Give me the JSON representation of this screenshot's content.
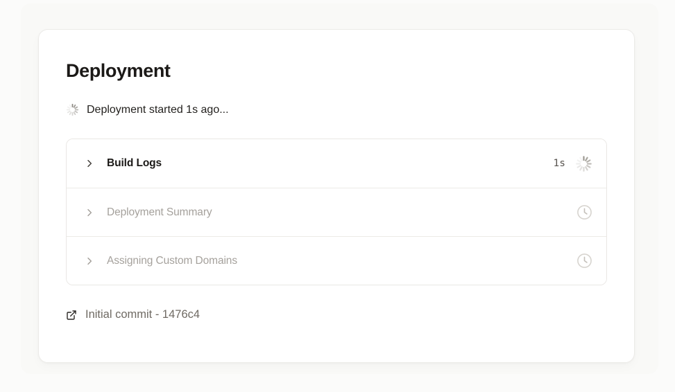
{
  "card": {
    "title": "Deployment",
    "status": {
      "text": "Deployment started 1s ago...",
      "icon": "spinner-icon"
    },
    "steps": [
      {
        "label": "Build Logs",
        "duration": "1s",
        "state": "in-progress",
        "right_icon": "spinner-icon"
      },
      {
        "label": "Deployment Summary",
        "duration": "",
        "state": "pending",
        "right_icon": "clock-icon"
      },
      {
        "label": "Assigning Custom Domains",
        "duration": "",
        "state": "pending",
        "right_icon": "clock-icon"
      }
    ],
    "commit": {
      "label": "Initial commit - 1476c4",
      "icon": "external-link-icon"
    }
  },
  "colors": {
    "page_bg": "#FBFBFA",
    "panel_bg": "#F9F9F7",
    "card_bg": "#FFFFFF",
    "card_border": "#ECEBE8",
    "title_text": "#1B1917",
    "muted_text": "#A5A19C",
    "duration_text": "#57534E",
    "commit_text": "#6F6A63",
    "spinner": "#8F8B85",
    "clock": "#D7D4CF"
  }
}
